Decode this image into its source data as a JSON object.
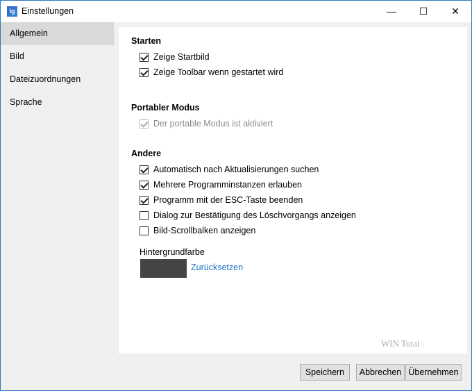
{
  "window": {
    "title": "Einstellungen",
    "icon": "app-icon",
    "controls": {
      "minimize": "—",
      "maximize": "☐",
      "close": "✕"
    }
  },
  "sidebar": {
    "items": [
      {
        "label": "Allgemein",
        "active": true
      },
      {
        "label": "Bild"
      },
      {
        "label": "Dateizuordnungen"
      },
      {
        "label": "Sprache"
      }
    ]
  },
  "sections": {
    "starten": {
      "title": "Starten",
      "options": [
        {
          "label": "Zeige Startbild",
          "checked": true
        },
        {
          "label": "Zeige Toolbar wenn gestartet wird",
          "checked": true
        }
      ]
    },
    "portabel": {
      "title": "Portabler Modus",
      "options": [
        {
          "label": "Der portable Modus ist aktiviert",
          "checked": true,
          "disabled": true
        }
      ]
    },
    "andere": {
      "title": "Andere",
      "options": [
        {
          "label": "Automatisch nach Aktualisierungen suchen",
          "checked": true
        },
        {
          "label": "Mehrere Programminstanzen erlauben",
          "checked": true
        },
        {
          "label": "Programm mit der ESC-Taste beenden",
          "checked": true
        },
        {
          "label": "Dialog zur Bestätigung des Löschvorgangs anzeigen",
          "checked": false
        },
        {
          "label": "Bild-Scrollbalken anzeigen",
          "checked": false
        }
      ]
    }
  },
  "background": {
    "label": "Hintergrundfarbe",
    "color": "#444444",
    "reset_label": "Zurücksetzen"
  },
  "watermark": "WIN Total",
  "buttons": {
    "save": "Speichern",
    "cancel": "Abbrechen",
    "apply": "Übernehmen"
  }
}
